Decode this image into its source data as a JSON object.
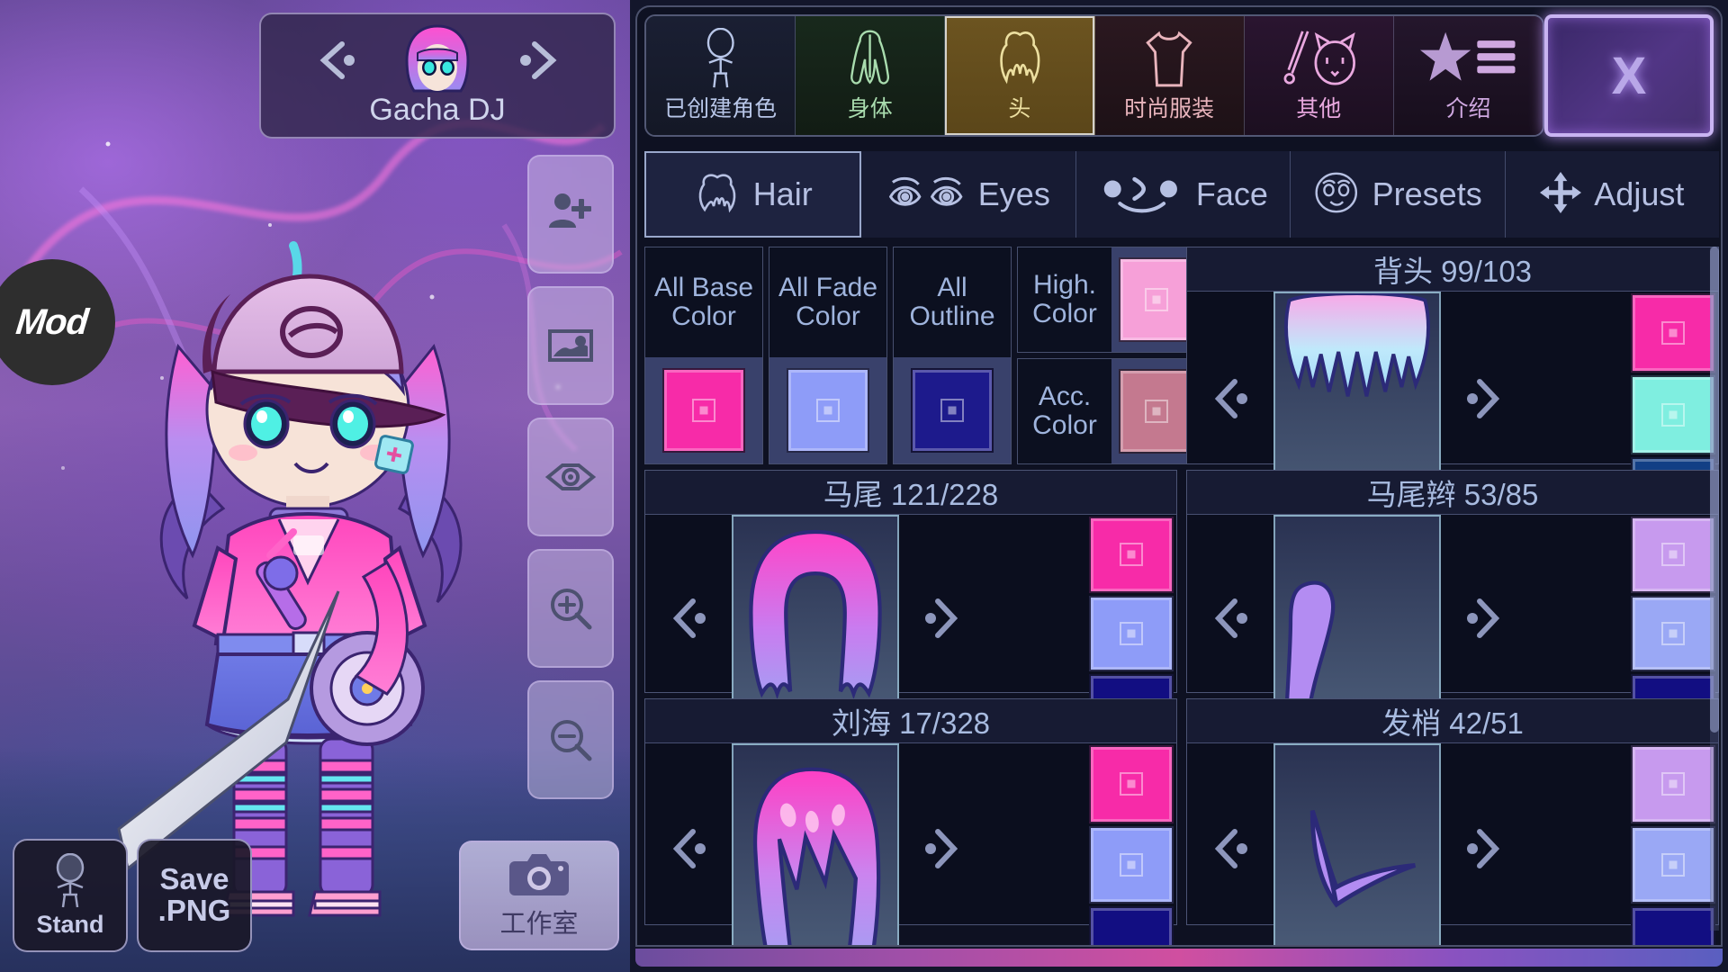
{
  "stage": {
    "mod_badge": "Mod",
    "character_card": {
      "name": "Gacha DJ",
      "prev_icon": "chevron-left-icon",
      "next_icon": "chevron-right-icon",
      "avatar_icon": "character-avatar"
    },
    "tool_buttons": [
      {
        "name": "add-character-button",
        "icon": "person-add-icon"
      },
      {
        "name": "background-button",
        "icon": "image-icon"
      },
      {
        "name": "preview-eye-button",
        "icon": "eye-icon"
      },
      {
        "name": "zoom-in-button",
        "icon": "magnify-plus-icon"
      },
      {
        "name": "zoom-out-button",
        "icon": "magnify-minus-icon"
      }
    ],
    "bottom_buttons": {
      "stand": {
        "label": "Stand",
        "icon": "standing-figure-icon"
      },
      "save": {
        "label_line1": "Save",
        "label_line2": ".PNG"
      },
      "studio": {
        "label": "工作室",
        "icon": "camera-icon"
      }
    }
  },
  "panel": {
    "close_label": "X",
    "category_tabs": [
      {
        "label": "已创建角色",
        "icon": "character-icon",
        "color": "#b8c6e8",
        "selected": false
      },
      {
        "label": "身体",
        "icon": "body-icon",
        "color": "#a9dcae",
        "selected": false
      },
      {
        "label": "头",
        "icon": "head-hair-icon",
        "color": "#ecdfa0",
        "selected": true
      },
      {
        "label": "时尚服装",
        "icon": "shirt-icon",
        "color": "#e8b4bc",
        "selected": false
      },
      {
        "label": "其他",
        "icon": "sword-cat-icon",
        "color": "#e9a8df",
        "selected": false
      },
      {
        "label": "介绍",
        "icon": "star-list-icon",
        "color": "#cfa8e0",
        "selected": false
      }
    ],
    "sub_tabs": [
      {
        "label": "Hair",
        "icon": "hair-icon",
        "selected": true
      },
      {
        "label": "Eyes",
        "icon": "eyes-icon",
        "selected": false
      },
      {
        "label": "Face",
        "icon": "face-icon",
        "selected": false
      },
      {
        "label": "Presets",
        "icon": "presets-icon",
        "selected": false
      },
      {
        "label": "Adjust",
        "icon": "move-arrows-icon",
        "selected": false
      }
    ],
    "color_presets": [
      {
        "name": "all-base-color",
        "line1": "All Base",
        "line2": "Color",
        "color": "#F72BA8"
      },
      {
        "name": "all-fade-color",
        "line1": "All Fade",
        "line2": "Color",
        "color": "#8E9CF8"
      },
      {
        "name": "all-outline",
        "line1": "All",
        "line2": "Outline",
        "color": "#1D1A8C"
      }
    ],
    "color_presets_small": [
      {
        "name": "high-color",
        "line1": "High.",
        "line2": "Color",
        "color": "#F6A0D8"
      },
      {
        "name": "acc-color",
        "line1": "Acc.",
        "line2": "Color",
        "color": "#C4798F"
      }
    ],
    "items": [
      {
        "name": "back-hair",
        "title": "背头 99/103",
        "preview": "back-hair-preview",
        "swatches": [
          "#F72BA8",
          "#7FEEE0",
          "#123F85"
        ]
      },
      {
        "name": "ponytail",
        "title": "马尾 121/228",
        "preview": "ponytail-preview",
        "swatches": [
          "#F72BA8",
          "#8E9CF8",
          "#120E82"
        ]
      },
      {
        "name": "braid",
        "title": "马尾辫 53/85",
        "preview": "braid-preview",
        "swatches": [
          "#C79AEE",
          "#9AA8F5",
          "#120E82"
        ]
      },
      {
        "name": "bangs",
        "title": "刘海 17/328",
        "preview": "bangs-preview",
        "swatches": [
          "#F72BA8",
          "#8E9CF8",
          "#120E82"
        ]
      },
      {
        "name": "hair-tips",
        "title": "发梢 42/51",
        "preview": "hair-tips-preview",
        "swatches": [
          "#C79AEE",
          "#9AA8F5",
          "#120E82"
        ]
      }
    ],
    "arrows": {
      "prev": "chevron-left-icon",
      "next": "chevron-right-icon"
    }
  }
}
